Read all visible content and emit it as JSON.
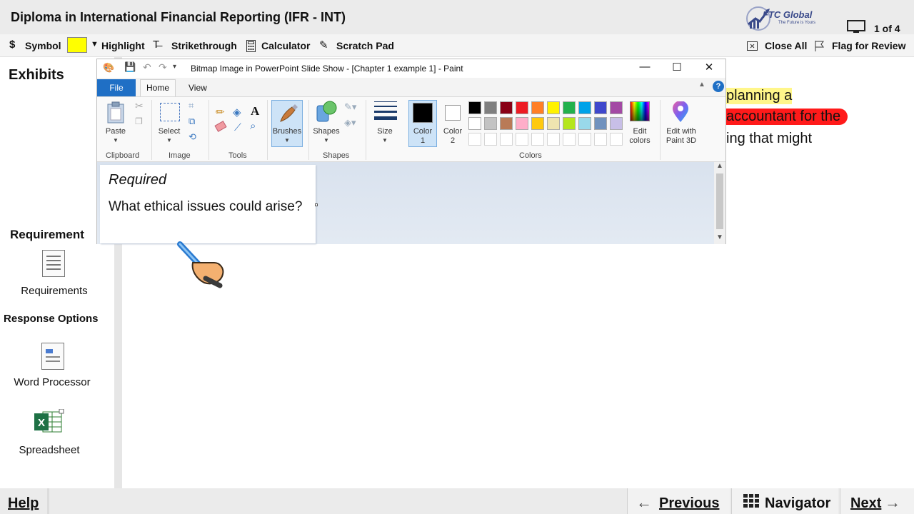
{
  "header": {
    "title": "Diploma in International Financial Reporting (IFR - INT)",
    "logo_name": "FTC Global",
    "logo_tagline": "The Future is Yours",
    "page_counter": "1 of 4"
  },
  "toolbar": {
    "symbol": "Symbol",
    "highlight": "Highlight",
    "highlight_color": "#ffff00",
    "strikethrough": "Strikethrough",
    "calculator": "Calculator",
    "scratch_pad": "Scratch Pad",
    "close_all": "Close All",
    "flag_for_review": "Flag for Review"
  },
  "sidebar": {
    "exhibits_heading": "Exhibits",
    "requirement_heading": "Requirement",
    "requirements_label": "Requirements",
    "response_heading": "Response Options",
    "word_processor_label": "Word Processor",
    "spreadsheet_label": "Spreadsheet"
  },
  "exhibit_text": {
    "line1": "planning a",
    "line2": "accountant for the",
    "line3": "ing that might"
  },
  "paint": {
    "window_title": "Bitmap Image in PowerPoint Slide Show - [Chapter 1 example 1] - Paint",
    "tabs": {
      "file": "File",
      "home": "Home",
      "view": "View"
    },
    "groups": {
      "clipboard": "Clipboard",
      "image": "Image",
      "tools": "Tools",
      "shapes": "Shapes",
      "colors": "Colors"
    },
    "items": {
      "paste": "Paste",
      "select": "Select",
      "brushes": "Brushes",
      "shapes": "Shapes",
      "size": "Size",
      "color1_a": "Color",
      "color1_b": "1",
      "color2_a": "Color",
      "color2_b": "2",
      "edit_colors_a": "Edit",
      "edit_colors_b": "colors",
      "paint3d_a": "Edit with",
      "paint3d_b": "Paint 3D"
    },
    "palette_row1": [
      "#000000",
      "#7f7f7f",
      "#880015",
      "#ed1c24",
      "#ff7f27",
      "#fff200",
      "#22b14c",
      "#00a2e8",
      "#3f48cc",
      "#a349a4"
    ],
    "palette_row2": [
      "#ffffff",
      "#c3c3c3",
      "#b97a57",
      "#ffaec9",
      "#ffc90e",
      "#efe4b0",
      "#b5e61d",
      "#99d9ea",
      "#7092be",
      "#c8bfe7"
    ],
    "canvas": {
      "required": "Required",
      "question": "What ethical issues could arise?"
    }
  },
  "bottom": {
    "help": "Help",
    "previous": "Previous",
    "navigator": "Navigator",
    "next": "Next"
  }
}
